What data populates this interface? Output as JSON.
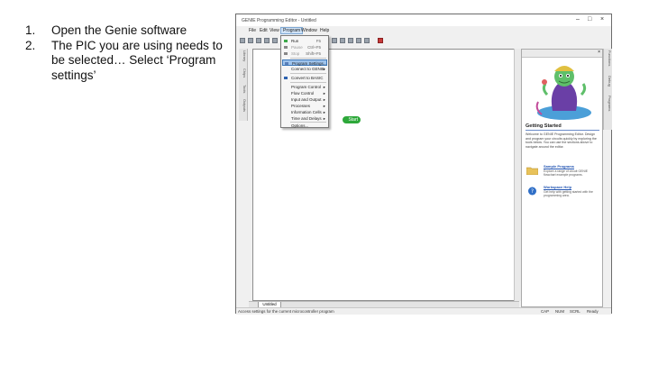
{
  "instructions": [
    {
      "num": "1.",
      "text": "Open the Genie software"
    },
    {
      "num": "2.",
      "text": "The PIC you are using needs to be selected… Select ‘Program settings’"
    }
  ],
  "window": {
    "title": "GENIE Programming Editor - Untitled",
    "controls": {
      "minimize": "–",
      "maximize": "□",
      "close": "×"
    }
  },
  "menubar": [
    "File",
    "Edit",
    "View",
    "Program",
    "Window",
    "Help"
  ],
  "program_menu": {
    "items": [
      {
        "label": "Run",
        "shortcut": "F5",
        "has_arrow": false
      },
      {
        "label": "Pause",
        "shortcut": "Ctrl+F5",
        "has_arrow": false
      },
      {
        "label": "Stop",
        "shortcut": "Shift+F5",
        "has_arrow": false
      },
      {
        "label": "Program Settings...",
        "shortcut": "",
        "has_arrow": false
      },
      {
        "label": "Connect to GENIE",
        "shortcut": "",
        "has_arrow": true
      },
      {
        "label": "Convert to BASIC",
        "shortcut": "",
        "has_arrow": false
      },
      {
        "label": "Program Control",
        "shortcut": "",
        "has_arrow": true
      },
      {
        "label": "Flow Control",
        "shortcut": "",
        "has_arrow": true
      },
      {
        "label": "Input and Output",
        "shortcut": "",
        "has_arrow": true
      },
      {
        "label": "Processes",
        "shortcut": "",
        "has_arrow": true
      },
      {
        "label": "Information Cells",
        "shortcut": "",
        "has_arrow": true
      },
      {
        "label": "Time and Delays",
        "shortcut": "",
        "has_arrow": true
      },
      {
        "label": "Options...",
        "shortcut": "",
        "has_arrow": false
      }
    ]
  },
  "left_tabs": [
    "Library",
    "Chips",
    "Tools",
    "Outputs"
  ],
  "right_tabs": [
    "Functions",
    "Debug",
    "Programs"
  ],
  "canvas": {
    "start_block": "Start"
  },
  "doc_tab": "Untitled",
  "side_panel": {
    "heading": "Getting Started",
    "intro": "Welcome to GENIE Programming Editor. Design and program your circuits quickly by exploring the tools below. You can use the sections above to navigate around the editor.",
    "links": [
      {
        "title": "Sample Programs",
        "desc": "Explore a range of circuit GENIE flowchart example programs."
      },
      {
        "title": "Workspace Help",
        "desc": "Get help with getting started with the programming area."
      }
    ]
  },
  "status": {
    "left": "Access settings for the current microcontroller program",
    "caps": "CAP",
    "num": "NUM",
    "scroll": "SCRL",
    "ready": "Ready"
  }
}
